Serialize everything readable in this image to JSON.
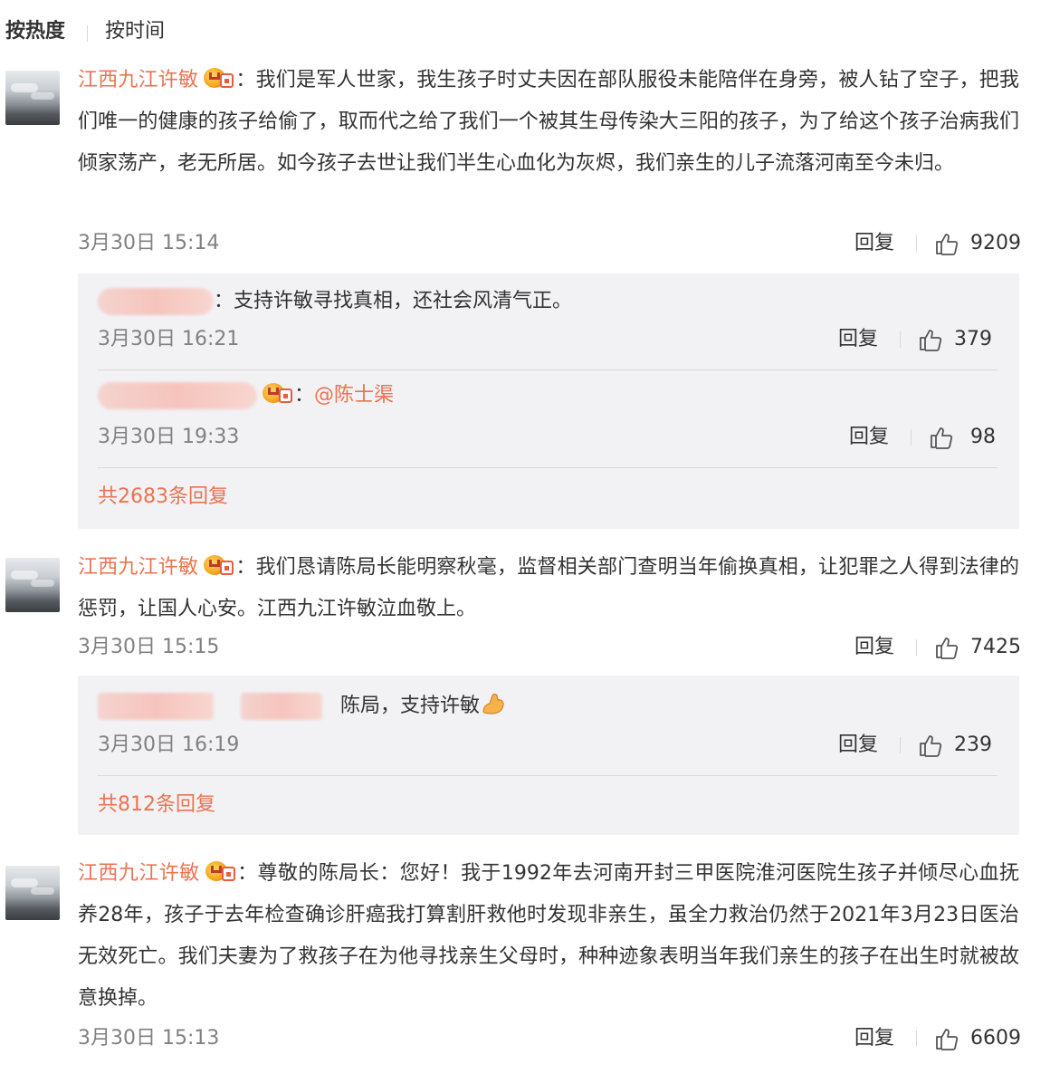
{
  "sort": {
    "hot": "按热度",
    "time": "按时间"
  },
  "reply_label": "回复",
  "comments": [
    {
      "user": "江西九江许敏",
      "text": "：我们是军人世家，我生孩子时丈夫因在部队服役未能陪伴在身旁，被人钻了空子，把我们唯一的健康的孩子给偷了，取而代之给了我们一个被其生母传染大三阳的孩子，为了给这个孩子治病我们倾家荡产，老无所居。如今孩子去世让我们半生心血化为灰烬，我们亲生的儿子流落河南至今未归。",
      "time": "3月30日 15:14",
      "likes": "9209",
      "replies": [
        {
          "text": "：支持许敏寻找真相，还社会风清气正。",
          "time": "3月30日 16:21",
          "likes": "379"
        },
        {
          "text": "：",
          "mention": "@陈士渠",
          "time": "3月30日 19:33",
          "likes": "98"
        }
      ],
      "more": "共2683条回复"
    },
    {
      "user": "江西九江许敏",
      "text": "：我们恳请陈局长能明察秋毫，监督相关部门查明当年偷换真相，让犯罪之人得到法律的惩罚，让国人心安。江西九江许敏泣血敬上。",
      "time": "3月30日 15:15",
      "likes": "7425",
      "replies": [
        {
          "text": "陈局，支持许敏",
          "time": "3月30日 16:19",
          "likes": "239"
        }
      ],
      "more": "共812条回复"
    },
    {
      "user": "江西九江许敏",
      "text": "：尊敬的陈局长：您好！我于1992年去河南开封三甲医院淮河医院生孩子并倾尽心血抚养28年，孩子于去年检查确诊肝癌我打算割肝救他时发现非亲生，虽全力救治仍然于2021年3月23日医治无效死亡。我们夫妻为了救孩子在为他寻找亲生父母时，种种迹象表明当年我们亲生的孩子在出生时就被故意换掉。",
      "time": "3月30日 15:13",
      "likes": "6609"
    }
  ],
  "colors": {
    "accent": "#eb7350",
    "meta": "#808080",
    "subbox": "#f2f2f5"
  },
  "icons": {
    "like": "thumbs-up-icon",
    "vip": "vip-crown-icon",
    "emoji": "flexed-biceps-emoji"
  }
}
